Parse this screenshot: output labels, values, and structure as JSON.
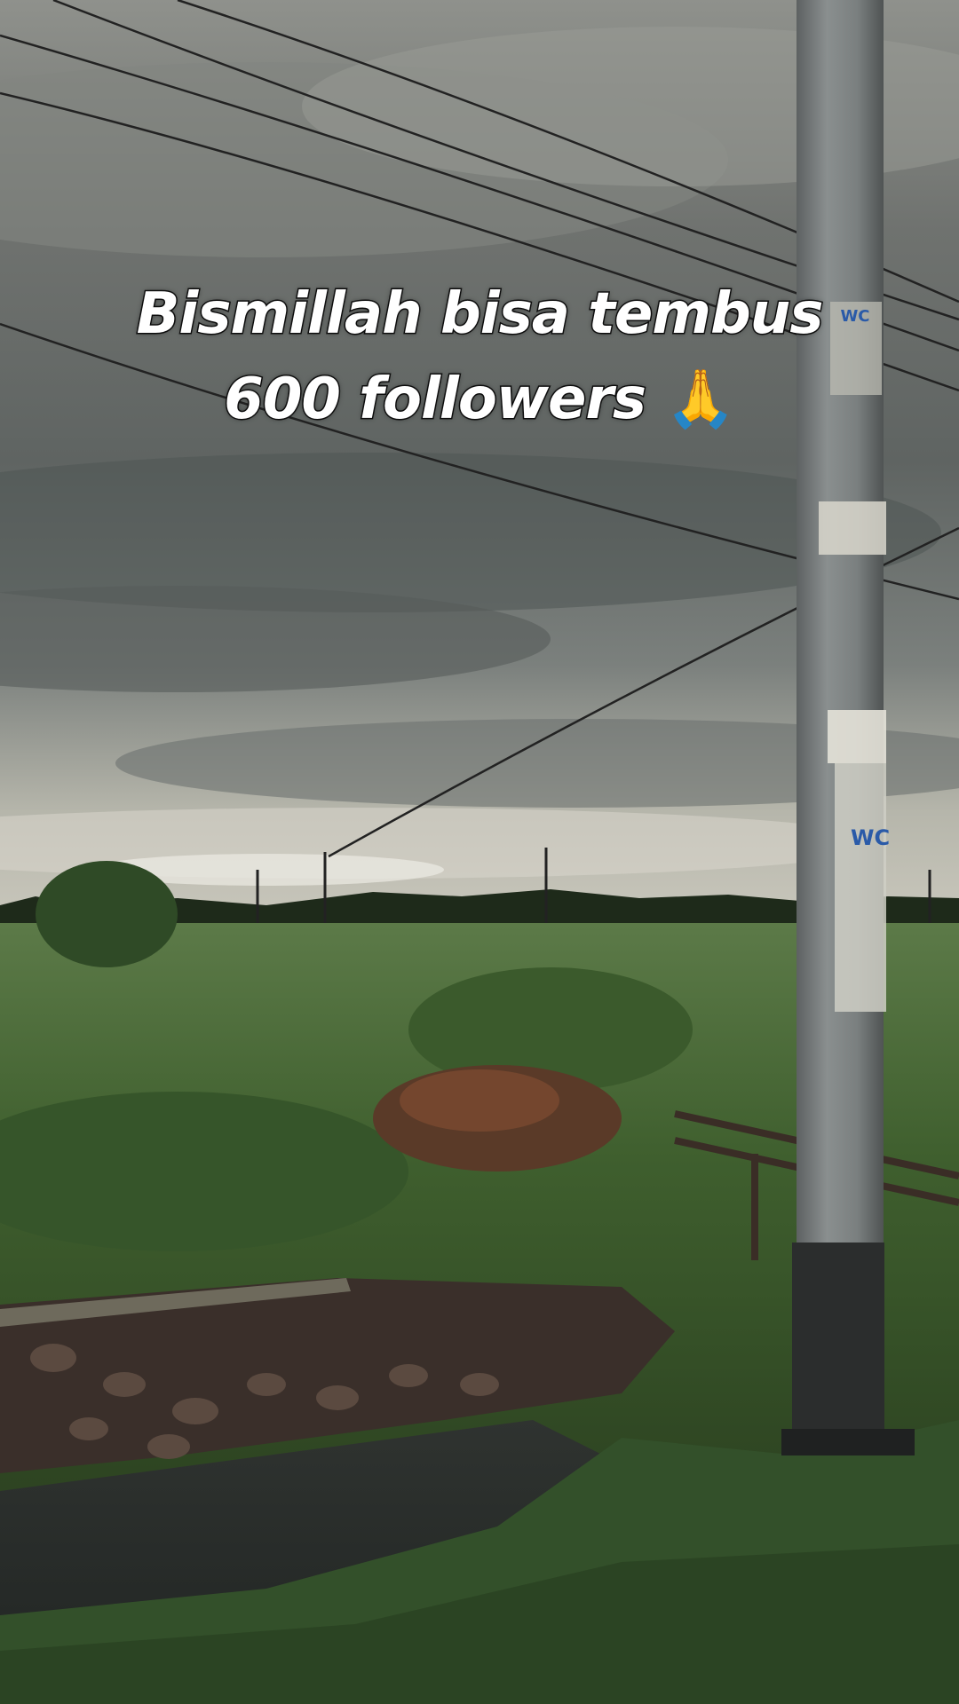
{
  "overlay_text": {
    "line1": "Bismillah bisa tembus",
    "line2": "600 followers",
    "emoji": "🙏"
  },
  "pole_signs": {
    "sign_top": "WC",
    "sign_mid": "WC"
  }
}
